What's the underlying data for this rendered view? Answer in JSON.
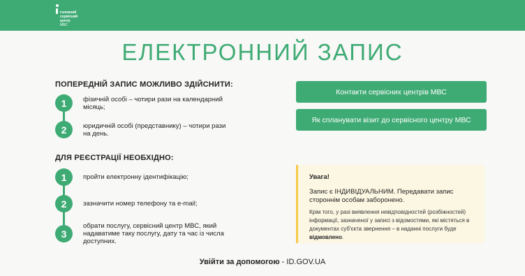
{
  "header": {
    "logo_line1": "головний",
    "logo_line2": "сервісний",
    "logo_line3": "центр",
    "logo_line4": "МВС"
  },
  "page_title": "ЕЛЕКТРОННИЙ ЗАПИС",
  "booking_section": {
    "title": "ПОПЕРЕДНІЙ ЗАПИС МОЖЛИВО ЗДІЙСНИТИ:",
    "items": [
      {
        "number": "1",
        "text": "фізичній особі – чотири рази на календарний місяць;"
      },
      {
        "number": "2",
        "text": "юридичній особі (представнику) – чотири рази на день."
      }
    ]
  },
  "registration_section": {
    "title": "ДЛЯ РЕЄСТРАЦІЇ НЕОБХІДНО:",
    "items": [
      {
        "number": "1",
        "text": "пройти електронну ідентифікацію;"
      },
      {
        "number": "2",
        "text": "зазначити номер телефону та e-mail;"
      },
      {
        "number": "3",
        "text": "обрати послугу, сервісний центр МВС, який надаватиме таку послугу, дату та час із числа доступних."
      }
    ]
  },
  "buttons": {
    "contacts": "Контакти сервісних центрів МВС",
    "plan_visit": "Як спланувати візит до сервісного центру МВС"
  },
  "notice": {
    "title": "Увага!",
    "main": "Запис є ІНДИВІДУАЛЬНИМ. Передавати запис стороннім особам заборонено.",
    "detail": "Крім того, у разі виявлення невідповідностей (розбіжностей) інформації, зазначеної у записі з відомостями, які містяться в документах суб'єкта звернення – в наданні послуги буде",
    "detail_emphasis": "відмовлено",
    "detail_end": "."
  },
  "footer": {
    "label": "Увійти за допомогою",
    "separator": " - ",
    "link": "ID.GOV.UA"
  },
  "colors": {
    "brand_green": "#3fab74",
    "notice_bg": "#fcf7e3",
    "notice_border": "#f6c94a"
  }
}
